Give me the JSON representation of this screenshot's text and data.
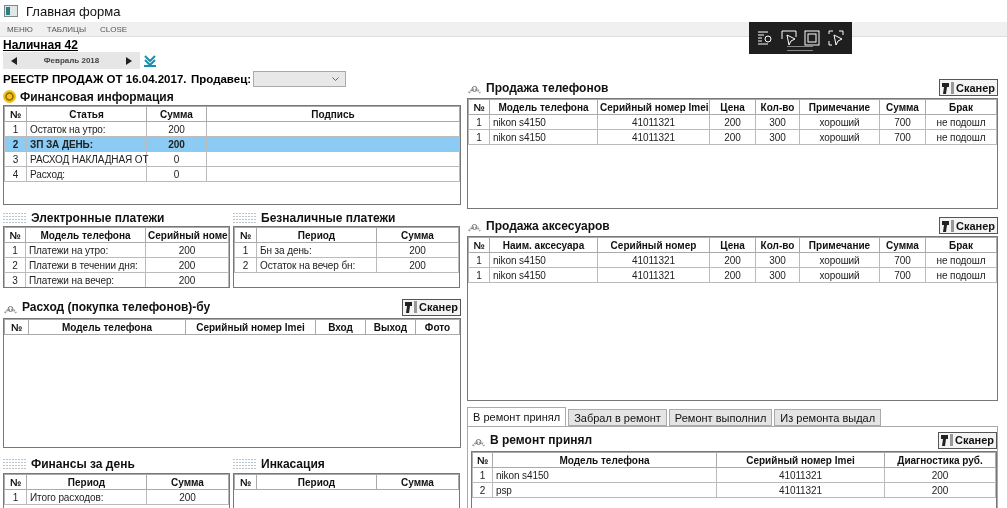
{
  "window": {
    "title": "Главная форма"
  },
  "menu": [
    "МЕНЮ",
    "ТАБЛИЦЫ",
    "CLOSE"
  ],
  "store": "Наличная 42",
  "month_picker": {
    "label": "Февраль 2018"
  },
  "register_title": "РЕЕСТР ПРОДАЖ ОТ 16.04.2017.",
  "seller": {
    "label": "Продавец:"
  },
  "left_rows": [
    [
      {
        "title": "Финансовая информация",
        "table": {
          "columns": [
            "№",
            "Статья",
            "Сумма",
            "Подпись"
          ],
          "rows": [
            {
              "cells": [
                "1",
                "Остаток на утро:",
                "200",
                ""
              ],
              "selected": false
            },
            {
              "cells": [
                "2",
                "ЗП ЗА ДЕНЬ:",
                "200",
                ""
              ],
              "selected": true
            },
            {
              "cells": [
                "3",
                "РАСХОД НАКЛАДНАЯ ОТ",
                "0",
                ""
              ],
              "selected": false
            },
            {
              "cells": [
                "4",
                "Расход:",
                "0",
                ""
              ],
              "selected": false
            }
          ]
        }
      }
    ],
    [
      {
        "title": "Электронные платежи",
        "table": {
          "columns": [
            "№",
            "Модель телефона",
            "Серийный номе"
          ],
          "rows": [
            {
              "cells": [
                "1",
                "Платежи на утро:",
                "200"
              ]
            },
            {
              "cells": [
                "2",
                "Платежи в течении дня:",
                "200"
              ]
            },
            {
              "cells": [
                "3",
                "Платежи на вечер:",
                "200"
              ]
            }
          ]
        }
      },
      {
        "title": "Безналичные платежи",
        "table": {
          "columns": [
            "№",
            "Период",
            "Сумма"
          ],
          "rows": [
            {
              "cells": [
                "1",
                "Бн за день:",
                "200"
              ]
            },
            {
              "cells": [
                "2",
                "Остаток на вечер бн:",
                "200"
              ]
            }
          ]
        }
      }
    ],
    [
      {
        "title": "Расход (покупка телефонов)-бу",
        "scanner": "Сканер",
        "table": {
          "columns": [
            "№",
            "Модель телефона",
            "Серийный номер Imei",
            "Вход",
            "Выход",
            "Фото"
          ]
        }
      }
    ],
    [
      {
        "title": "Финансы за день",
        "table": {
          "columns": [
            "№",
            "Период",
            "Сумма"
          ],
          "rows": [
            {
              "cells": [
                "1",
                "Итого расходов:",
                "200"
              ]
            }
          ]
        }
      },
      {
        "title": "Инкасация",
        "table": {
          "columns": [
            "№",
            "Период",
            "Сумма"
          ]
        }
      }
    ]
  ],
  "right_panels": [
    {
      "title": "Продажа телефонов",
      "scanner": "Сканер",
      "table": {
        "columns": [
          "№",
          "Модель телефона",
          "Серийный номер Imei",
          "Цена",
          "Кол-во",
          "Примечание",
          "Сумма",
          "Брак"
        ],
        "rows": [
          {
            "cells": [
              "1",
              "nikon s4150",
              "41011321",
              "200",
              "300",
              "хороший",
              "700",
              "не подошл"
            ]
          },
          {
            "cells": [
              "1",
              "nikon s4150",
              "41011321",
              "200",
              "300",
              "хороший",
              "700",
              "не подошл"
            ]
          }
        ]
      }
    },
    {
      "title": "Продажа аксесуаров",
      "scanner": "Сканер",
      "table": {
        "columns": [
          "№",
          "Наим. аксесуара",
          "Серийный номер",
          "Цена",
          "Кол-во",
          "Примечание",
          "Сумма",
          "Брак"
        ],
        "rows": [
          {
            "cells": [
              "1",
              "nikon s4150",
              "41011321",
              "200",
              "300",
              "хороший",
              "700",
              "не подошл"
            ]
          },
          {
            "cells": [
              "1",
              "nikon s4150",
              "41011321",
              "200",
              "300",
              "хороший",
              "700",
              "не подошл"
            ]
          }
        ]
      }
    }
  ],
  "repair_tabs": [
    {
      "label": "В ремонт принял",
      "selected": true
    },
    {
      "label": "Забрал в ремонт",
      "selected": false
    },
    {
      "label": "Ремонт выполнил",
      "selected": false
    },
    {
      "label": "Из ремонта выдал",
      "selected": false
    }
  ],
  "repair_panel": {
    "title": "В ремонт принял",
    "scanner": "Сканер",
    "table": {
      "columns": [
        "№",
        "Модель телефона",
        "Серийный номер Imei",
        "Диагностика руб."
      ],
      "rows": [
        {
          "cells": [
            "1",
            "nikon s4150",
            "41011321",
            "200"
          ]
        },
        {
          "cells": [
            "2",
            "psp",
            "41011321",
            "200"
          ]
        }
      ]
    }
  }
}
